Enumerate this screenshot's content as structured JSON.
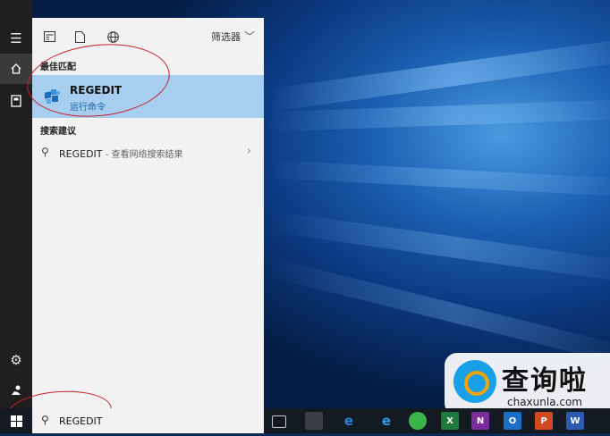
{
  "toolbar": {
    "icons": [
      "apps-icon",
      "document-icon",
      "globe-icon"
    ],
    "filter_label": "筛选器"
  },
  "best_match": {
    "section_title": "最佳匹配",
    "app_name": "REGEDIT",
    "app_type": "运行命令"
  },
  "suggestions": {
    "section_title": "搜索建议",
    "items": [
      {
        "query": "REGEDIT",
        "note": " - 查看网络搜索结果"
      }
    ]
  },
  "search": {
    "query": "REGEDIT"
  },
  "watermark": {
    "cn": "查询啦",
    "en": "chaxunla.com"
  },
  "taskbar": {
    "apps": [
      {
        "name": "task-view-icon",
        "label": ""
      },
      {
        "name": "store-icon",
        "label": ""
      },
      {
        "name": "ie-icon",
        "label": "e"
      },
      {
        "name": "edge-icon",
        "label": "e"
      },
      {
        "name": "app360-icon",
        "label": ""
      },
      {
        "name": "excel-icon",
        "label": "X"
      },
      {
        "name": "onenote-icon",
        "label": "N"
      },
      {
        "name": "outlook-icon",
        "label": "O"
      },
      {
        "name": "powerpoint-icon",
        "label": "P"
      },
      {
        "name": "word-icon",
        "label": "W"
      }
    ]
  },
  "colors": {
    "highlight": "#a7cdef",
    "annotation": "#c8202a",
    "accent": "#1b5fa8"
  }
}
